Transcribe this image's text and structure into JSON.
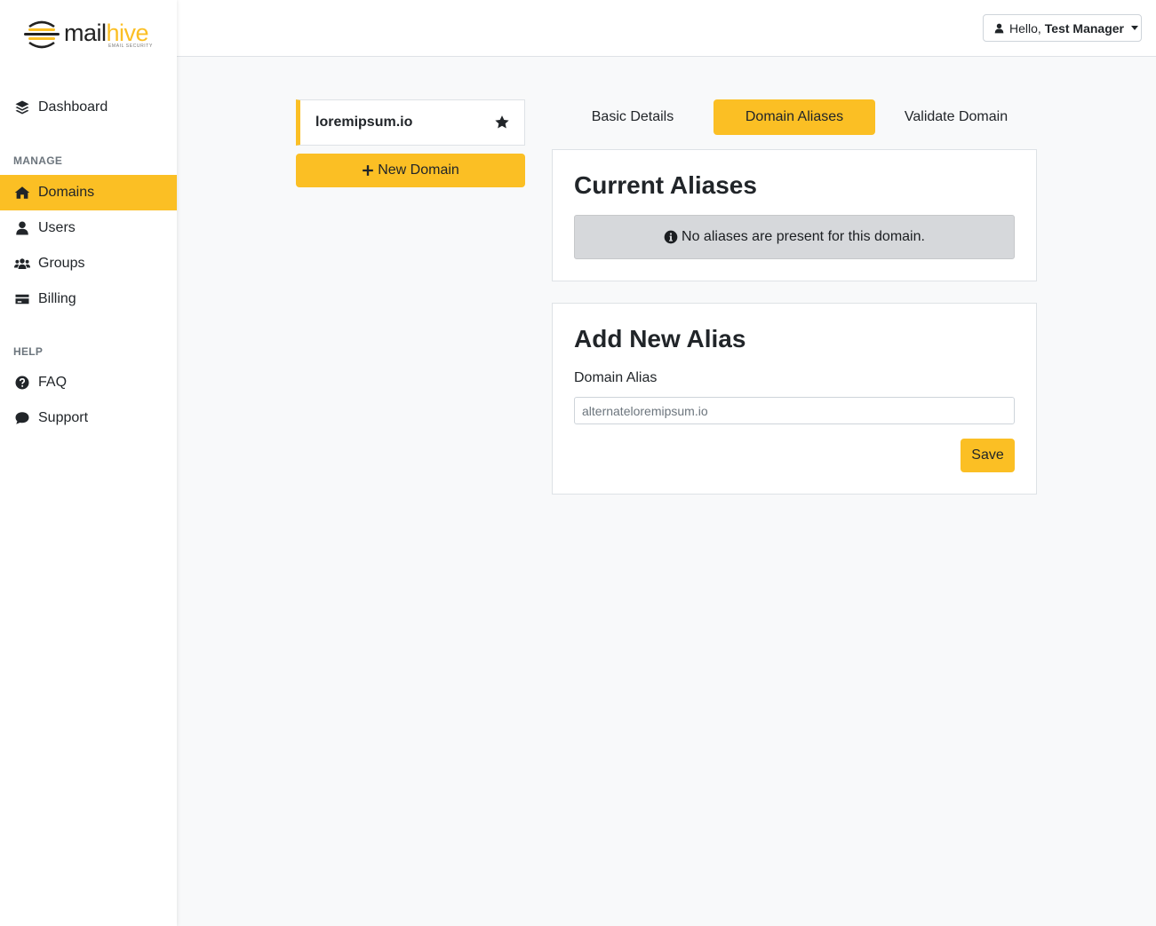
{
  "brand": {
    "word_main": "mail",
    "word_accent": "hive",
    "tagline": "EMAIL SECURITY",
    "accent_color": "#fbbf24"
  },
  "sidebar": {
    "dashboard": {
      "label": "Dashboard",
      "icon": "layers-icon"
    },
    "manage_heading": "MANAGE",
    "manage_items": [
      {
        "label": "Domains",
        "icon": "home-icon",
        "active": true
      },
      {
        "label": "Users",
        "icon": "user-icon"
      },
      {
        "label": "Groups",
        "icon": "users-icon"
      },
      {
        "label": "Billing",
        "icon": "credit-card-icon"
      }
    ],
    "help_heading": "HELP",
    "help_items": [
      {
        "label": "FAQ",
        "icon": "question-circle-icon"
      },
      {
        "label": "Support",
        "icon": "comment-icon"
      }
    ]
  },
  "topbar": {
    "greeting": "Hello,",
    "user_name": "Test Manager"
  },
  "domains": {
    "selected": "loremipsum.io",
    "new_button": "New Domain"
  },
  "tabs": [
    {
      "label": "Basic Details"
    },
    {
      "label": "Domain Aliases",
      "active": true
    },
    {
      "label": "Validate Domain"
    }
  ],
  "current_aliases": {
    "title": "Current Aliases",
    "empty_message": "No aliases are present for this domain."
  },
  "add_alias": {
    "title": "Add New Alias",
    "field_label": "Domain Alias",
    "placeholder": "alternateloremipsum.io",
    "save_label": "Save"
  }
}
